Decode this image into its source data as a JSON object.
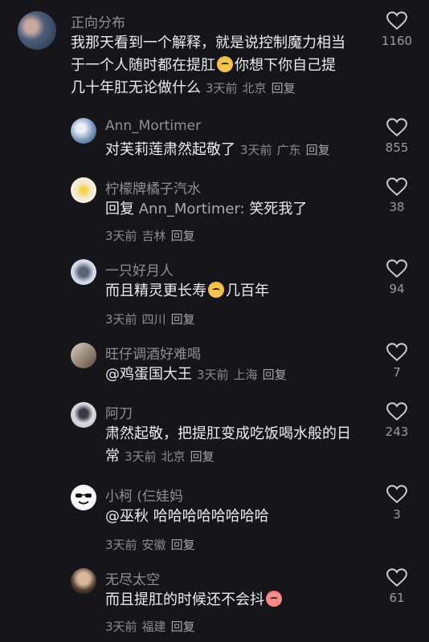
{
  "comments": [
    {
      "username": "正向分布",
      "text_parts": [
        "我那天看到一个解释，就是说控制魔力相当",
        "于一个人随时都在提肛",
        "你想下你自己提",
        "几十年肛无论做什么"
      ],
      "date": "3天前",
      "location": "北京",
      "reply_label": "回复",
      "likes": "1160"
    }
  ],
  "replies": [
    {
      "username": "Ann_Mortimer",
      "text": "对芙莉莲肃然起敬了",
      "date": "3天前",
      "location": "广东",
      "reply_label": "回复",
      "likes": "855",
      "avatar_color": "#6f8fb0"
    },
    {
      "username": "柠檬牌橘子汽水",
      "reply_prefix": "回复",
      "mention": "Ann_Mortimer:",
      "text": "笑死我了",
      "date": "3天前",
      "location": "吉林",
      "reply_label": "回复",
      "likes": "38",
      "avatar_color": "#f2e6c8"
    },
    {
      "username": "一只好月人",
      "text": "而且精灵更长寿",
      "text_after": "几百年",
      "date": "3天前",
      "location": "四川",
      "reply_label": "回复",
      "likes": "94",
      "avatar_color": "#cfd6e4"
    },
    {
      "username": "旺仔调酒好难喝",
      "text": "@鸡蛋国大王",
      "date": "3天前",
      "location": "上海",
      "reply_label": "回复",
      "likes": "7",
      "avatar_color": "#b6a89c"
    },
    {
      "username": "阿刀",
      "text_line1": "肃然起敬，把提肛变成吃饭喝水般的日",
      "text_line2": "常",
      "date": "3天前",
      "location": "北京",
      "reply_label": "回复",
      "likes": "243",
      "avatar_color": "#d9dbe0"
    },
    {
      "username": "小柯 (仨娃妈",
      "text": "@巫秋 哈哈哈哈哈哈哈哈",
      "date": "3天前",
      "location": "安徽",
      "reply_label": "回复",
      "likes": "3",
      "avatar_color": "#f5f5f5"
    },
    {
      "username": "无尽太空",
      "text": "而且提肛的时候还不会抖",
      "date": "3天前",
      "location": "福建",
      "reply_label": "回复",
      "likes": "61",
      "avatar_color": "#8a7a6a"
    }
  ],
  "icons": {
    "like": "heart-outline-icon",
    "emoji": "emoji-sticker-icon"
  },
  "colors": {
    "background": "#16161a",
    "text": "#ececef",
    "meta": "#8a8a90",
    "username": "#8f8f96"
  }
}
